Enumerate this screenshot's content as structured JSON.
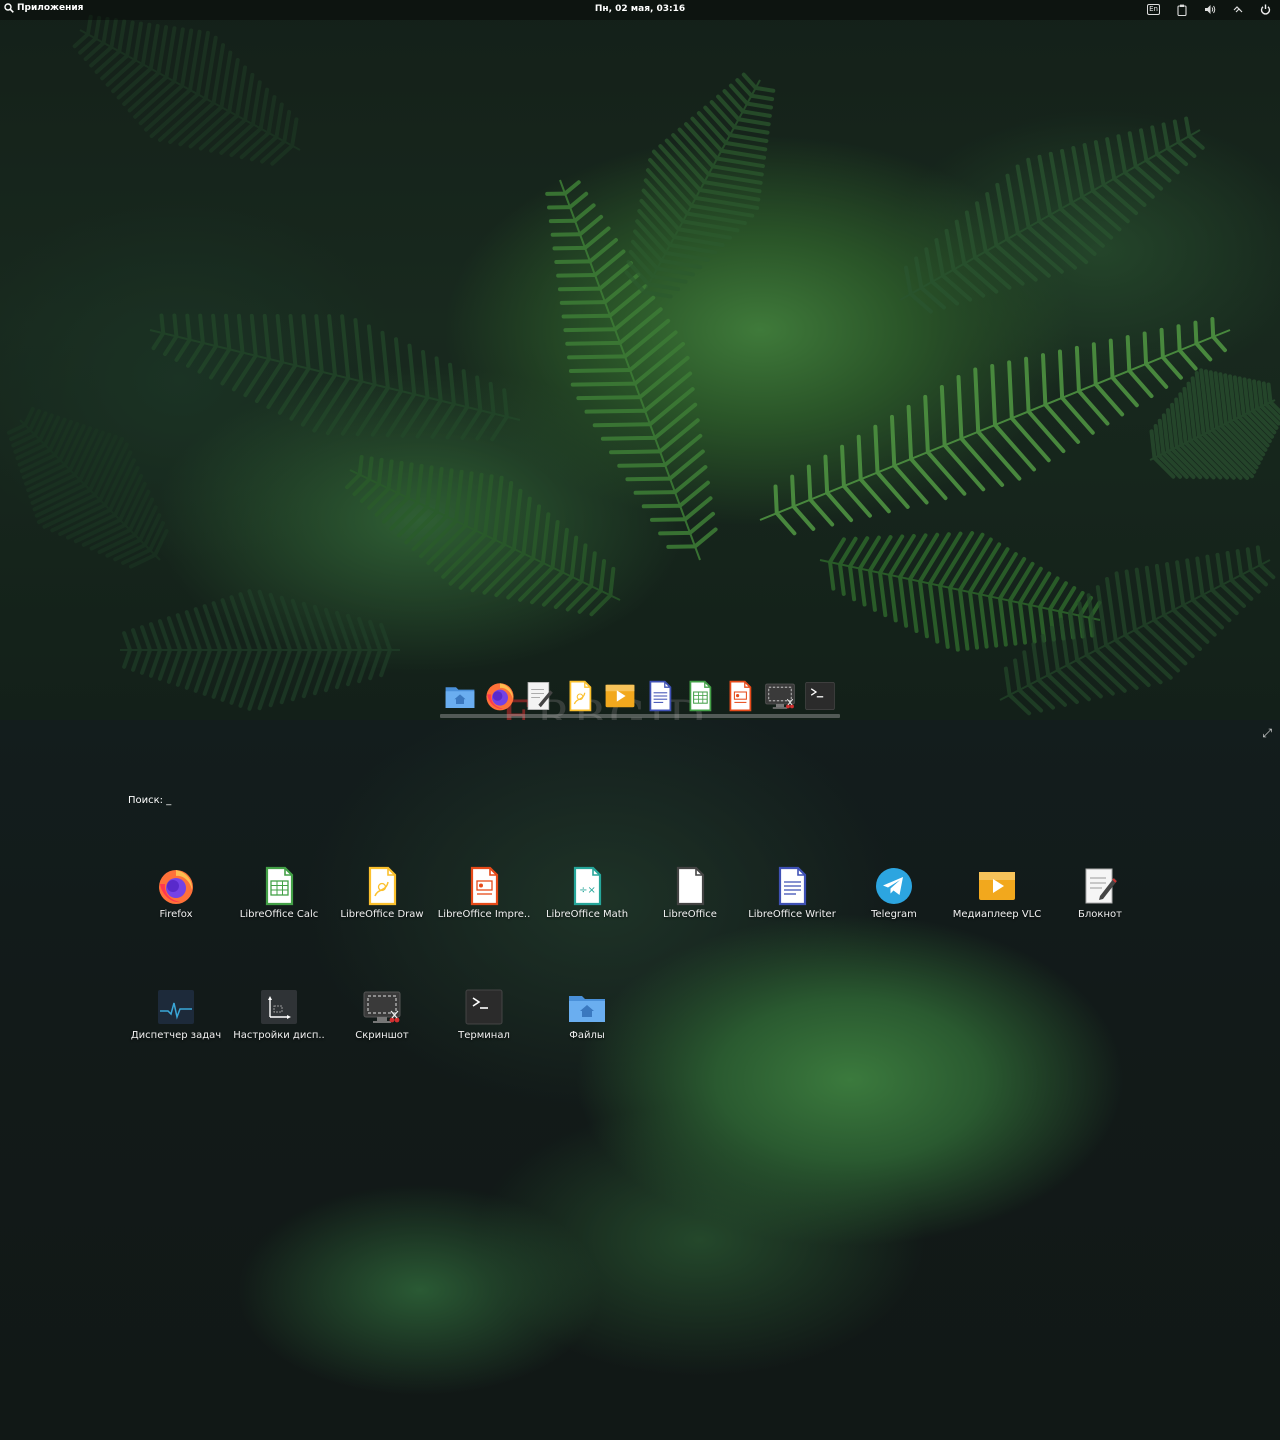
{
  "topbar": {
    "apps_label": "Приложения",
    "clock": "Пн, 02 мая, 03:16",
    "tray": [
      {
        "icon": "keyboard-layout-icon",
        "text": "En"
      },
      {
        "icon": "clipboard-icon"
      },
      {
        "icon": "volume-icon"
      },
      {
        "icon": "network-icon"
      },
      {
        "icon": "power-icon"
      }
    ]
  },
  "dock": {
    "items": [
      {
        "name": "files",
        "icon": "folder-home-icon"
      },
      {
        "name": "firefox",
        "icon": "firefox-icon"
      },
      {
        "name": "text-editor",
        "icon": "text-editor-icon"
      },
      {
        "name": "libreoffice-draw",
        "icon": "draw-icon"
      },
      {
        "name": "vlc",
        "icon": "media-player-icon"
      },
      {
        "name": "libreoffice-writer",
        "icon": "writer-icon"
      },
      {
        "name": "libreoffice-calc",
        "icon": "calc-icon"
      },
      {
        "name": "libreoffice-impress",
        "icon": "impress-icon"
      },
      {
        "name": "screenshot",
        "icon": "screenshot-icon"
      },
      {
        "name": "terminal",
        "icon": "terminal-icon"
      }
    ]
  },
  "watermark": {
    "first": "E",
    "rest": "RBGID"
  },
  "overview": {
    "search_label": "Поиск: _",
    "apps": [
      {
        "label": "Firefox",
        "icon": "firefox-icon"
      },
      {
        "label": "LibreOffice Calc",
        "icon": "calc-icon"
      },
      {
        "label": "LibreOffice Draw",
        "icon": "draw-icon"
      },
      {
        "label": "LibreOffice Impre..",
        "icon": "impress-icon"
      },
      {
        "label": "LibreOffice Math",
        "icon": "math-icon"
      },
      {
        "label": "LibreOffice",
        "icon": "libreoffice-icon"
      },
      {
        "label": "LibreOffice Writer",
        "icon": "writer-icon"
      },
      {
        "label": "Telegram",
        "icon": "telegram-icon"
      },
      {
        "label": "Медиаплеер VLC",
        "icon": "media-player-icon"
      },
      {
        "label": "Блокнот",
        "icon": "notepad-icon"
      },
      {
        "label": "Диспетчер задач",
        "icon": "task-manager-icon"
      },
      {
        "label": "Настройки дисп..",
        "icon": "display-settings-icon"
      },
      {
        "label": "Скриншот",
        "icon": "screenshot-icon"
      },
      {
        "label": "Терминал",
        "icon": "terminal-icon"
      },
      {
        "label": "Файлы",
        "icon": "folder-home-icon"
      }
    ]
  }
}
